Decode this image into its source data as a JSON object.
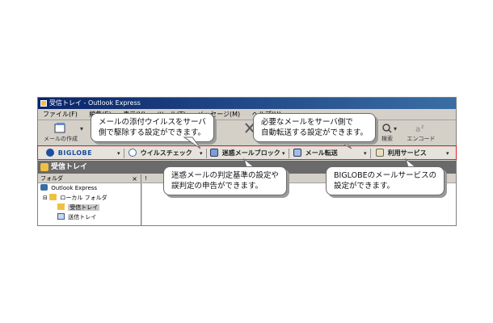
{
  "window": {
    "title": "受信トレイ - Outlook Express"
  },
  "menu": [
    "ファイル(F)",
    "編集(E)",
    "表示(V)",
    "ツール(T)",
    "メッセージ(M)",
    "ヘルプ(H)"
  ],
  "toolbar": {
    "compose_label": "メールの作成",
    "search_label": "検索",
    "encode_label": "エンコード"
  },
  "biglobe_bar": {
    "logo": "BIGLOBE",
    "virus_check": "ウイルスチェック",
    "spam_block": "迷惑メールブロック",
    "mail_forward": "メール転送",
    "services": "利用サービス"
  },
  "folder_header": "受信トレイ",
  "folder_pane": {
    "title": "フォルダ",
    "close": "×",
    "items": [
      "Outlook Express",
      "ローカル フォルダ",
      "受信トレイ",
      "送信トレイ"
    ]
  },
  "callouts": {
    "virus": [
      "メールの添付ウイルスをサーバ",
      "側で駆除する設定ができます。"
    ],
    "forward": [
      "必要なメールをサーバ側で",
      "自動転送する設定ができます。"
    ],
    "spam": [
      "迷惑メールの判定基準の設定や",
      "誤判定の申告ができます。"
    ],
    "services": [
      "BIGLOBEのメールサービスの",
      "設定ができます。"
    ]
  },
  "colors": {
    "highlight": "#e02020",
    "titlebar": "#0a246a",
    "biglobe_blue": "#1b4fa0"
  }
}
